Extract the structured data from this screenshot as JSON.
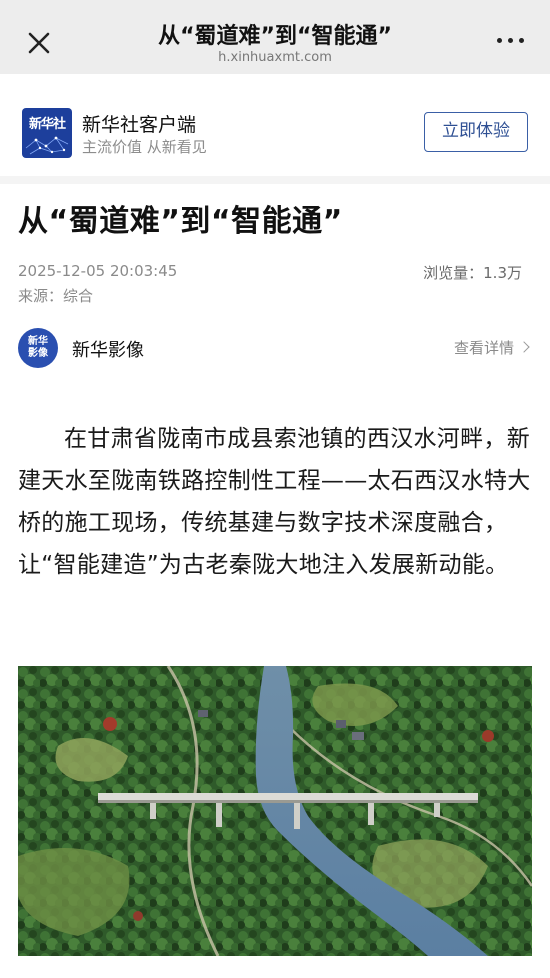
{
  "topbar": {
    "title": "从“蜀道难”到“智能通”",
    "url": "h.xinhuaxmt.com",
    "close_icon": "close-icon",
    "more_icon": "more-horizontal-icon"
  },
  "appbar": {
    "logo_text": "新华社",
    "app_name": "新华社客户端",
    "slogan": "主流价值 从新看见",
    "cta_label": "立即体验",
    "brand_color": "#1d3f9c"
  },
  "article": {
    "headline": "从“蜀道难”到“智能通”",
    "datetime": "2025-12-05 20:03:45",
    "views": "浏览量：1.3万",
    "source": "来源：综合",
    "author": {
      "avatar_text": "新华\n影像",
      "name": "新华影像",
      "detail_label": "查看详情"
    },
    "paragraph": "在甘肃省陇南市成县索池镇的西汉水河畔，新建天水至陇南铁路控制性工程——太石西汉水特大桥的施工现场，传统基建与数字技术深度融合，让“智能建造”为古老秦陇大地注入发展新动能。"
  },
  "figure": {
    "subject": "aerial-illustration-bridge-over-river"
  }
}
